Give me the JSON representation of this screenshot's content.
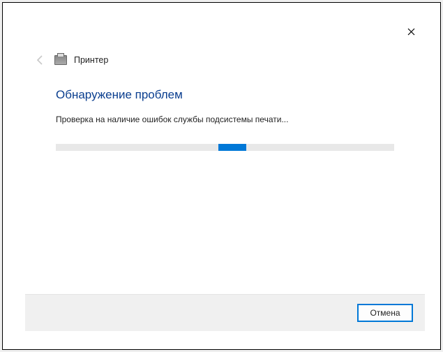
{
  "window": {
    "title": "Принтер"
  },
  "content": {
    "heading": "Обнаружение проблем",
    "status": "Проверка на наличие ошибок службы подсистемы печати..."
  },
  "footer": {
    "cancel_label": "Отмена"
  },
  "colors": {
    "accent": "#0078d7",
    "heading": "#0a3e8f"
  },
  "progress": {
    "mode": "indeterminate"
  }
}
